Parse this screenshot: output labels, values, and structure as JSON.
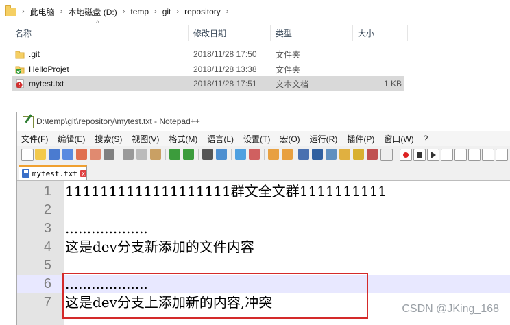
{
  "explorer": {
    "breadcrumb": [
      "此电脑",
      "本地磁盘 (D:)",
      "temp",
      "git",
      "repository"
    ],
    "columns": {
      "name": "名称",
      "date": "修改日期",
      "type": "类型",
      "size": "大小"
    },
    "files": [
      {
        "icon": "folder-icon",
        "name": ".git",
        "date": "2018/11/28 17:50",
        "type": "文件夹",
        "size": ""
      },
      {
        "icon": "synced-folder-icon",
        "name": "HelloProjet",
        "date": "2018/11/28 13:38",
        "type": "文件夹",
        "size": ""
      },
      {
        "icon": "conflict-file-icon",
        "name": "mytest.txt",
        "date": "2018/11/28 17:51",
        "type": "文本文档",
        "size": "1 KB"
      }
    ]
  },
  "notepad": {
    "title": "D:\\temp\\git\\repository\\mytest.txt - Notepad++",
    "menu": [
      "文件(F)",
      "编辑(E)",
      "搜索(S)",
      "视图(V)",
      "格式(M)",
      "语言(L)",
      "设置(T)",
      "宏(O)",
      "运行(R)",
      "插件(P)",
      "窗口(W)",
      "?"
    ],
    "tab_label": "mytest.txt",
    "lines": [
      {
        "num": "1",
        "text": "1111111111111111111群文全文群1111111111"
      },
      {
        "num": "2",
        "text": ""
      },
      {
        "num": "3",
        "text": "..................."
      },
      {
        "num": "4",
        "text": "这是dev分支新添加的文件内容"
      },
      {
        "num": "5",
        "text": ""
      },
      {
        "num": "6",
        "text": "..................."
      },
      {
        "num": "7",
        "text": "这是dev分支上添加新的内容,冲突"
      }
    ]
  },
  "watermark": "CSDN @JKing_168",
  "colors": {
    "highlight_box": "#d42a2a",
    "current_line": "#e8e8ff",
    "selected_row": "#d9d9d9"
  }
}
